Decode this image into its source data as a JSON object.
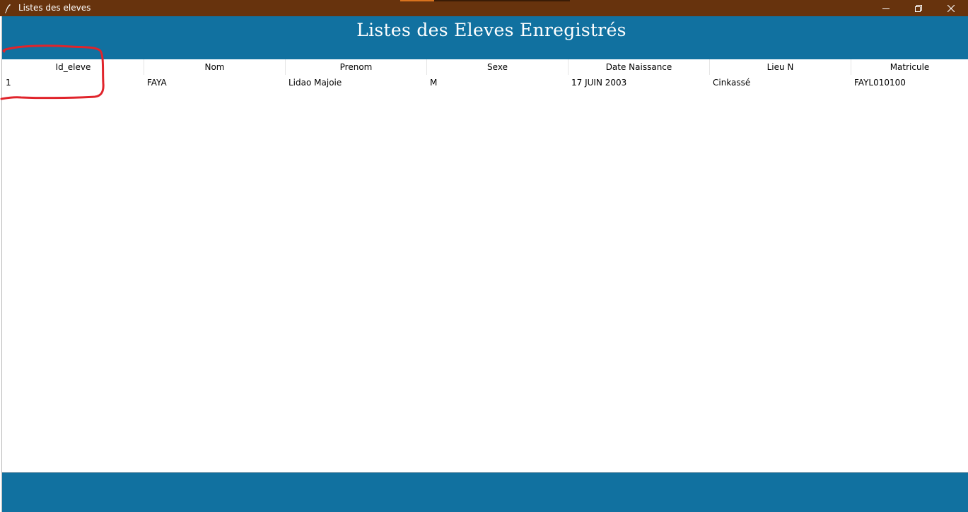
{
  "window": {
    "title": "Listes des eleves",
    "titlebar_color": "#67330d",
    "controls": {
      "minimize": "minimize-icon",
      "maximize": "restore-icon",
      "close": "close-icon"
    }
  },
  "header": {
    "title": "Listes des Eleves Enregistrés",
    "color": "#1171a0"
  },
  "table": {
    "columns": [
      "Id_eleve",
      "Nom",
      "Prenom",
      "Sexe",
      "Date Naissance",
      "Lieu N",
      "Matricule"
    ],
    "rows": [
      [
        "1",
        "FAYA",
        "Lidao Majoie",
        "M",
        "17 JUIN 2003",
        "Cinkassé",
        "FAYL010100"
      ]
    ]
  },
  "annotation": {
    "color": "#e0242b",
    "target": "Id_eleve column"
  },
  "footer": {
    "color": "#1171a0"
  }
}
